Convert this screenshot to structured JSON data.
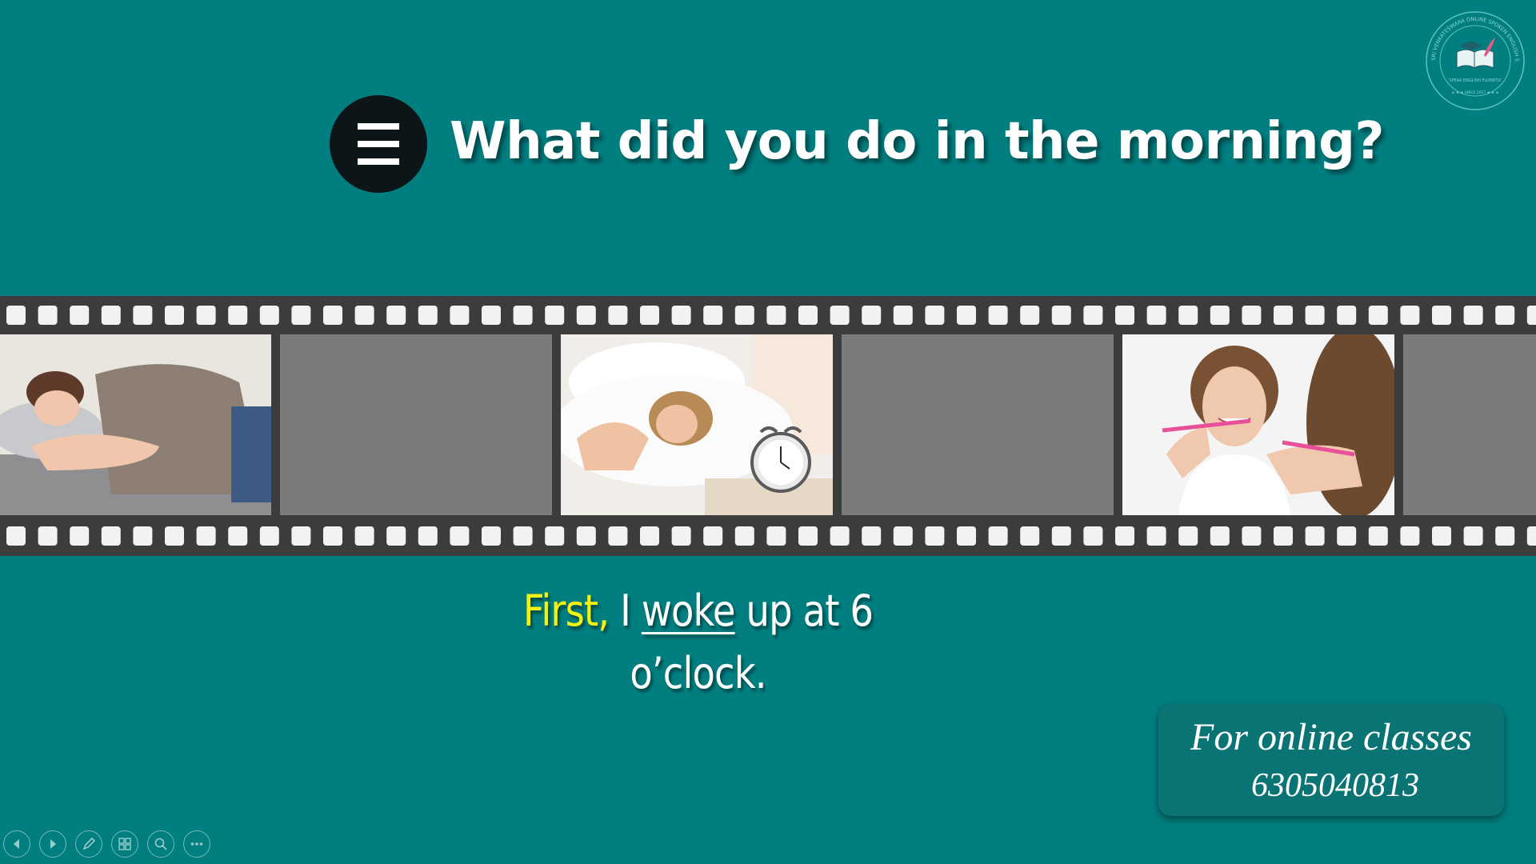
{
  "slide": {
    "title": "What did you do in the morning?",
    "sentence": {
      "first": "First,",
      "part1": "I",
      "verb": "woke",
      "part2": "up at 6",
      "line2": "o’clock."
    }
  },
  "contact": {
    "line1": "For online classes",
    "phone": "6305040813"
  },
  "logo": {
    "text_top": "SRI VENKATESWARA ONLINE SPOKEN ENGLISH SCHOOL",
    "text_mid": "SPEAK ENGLISH FLUENTLY",
    "text_bottom": "SINCE 2017"
  },
  "film_frames": [
    {
      "name": "frame-woman-sleeping",
      "filled": true
    },
    {
      "name": "frame-empty-1",
      "filled": false
    },
    {
      "name": "frame-woman-alarm-clock",
      "filled": true
    },
    {
      "name": "frame-empty-2",
      "filled": false
    },
    {
      "name": "frame-woman-brushing-teeth",
      "filled": true
    },
    {
      "name": "frame-empty-3",
      "filled": false
    }
  ],
  "toolbar": {
    "icons": [
      "previous-icon",
      "next-icon",
      "pen-icon",
      "slides-grid-icon",
      "zoom-icon",
      "more-icon"
    ]
  },
  "colors": {
    "background": "#017f80",
    "film": "#3c3c3c",
    "highlight": "#f4f20f",
    "menu_circle": "#0c1518"
  }
}
